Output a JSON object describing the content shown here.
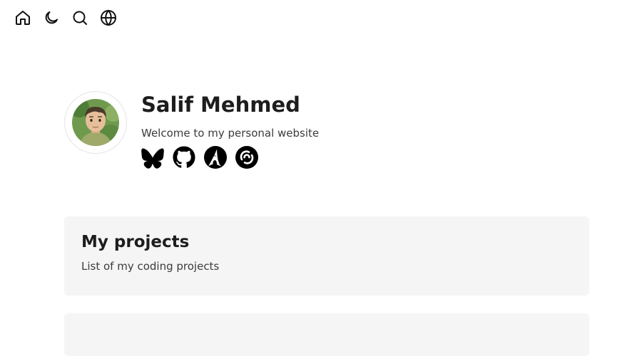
{
  "nav": {
    "items": [
      {
        "icon": "home-icon"
      },
      {
        "icon": "moon-icon"
      },
      {
        "icon": "search-icon"
      },
      {
        "icon": "globe-icon"
      }
    ]
  },
  "profile": {
    "name": "Salif Mehmed",
    "tagline": "Welcome to my personal website",
    "avatar_icon": "avatar-illustration",
    "socials": [
      {
        "icon": "bluesky-icon"
      },
      {
        "icon": "github-icon"
      },
      {
        "icon": "arch-icon"
      },
      {
        "icon": "keybase-icon"
      }
    ]
  },
  "sections": [
    {
      "title": "My projects",
      "description": "List of my coding projects"
    }
  ],
  "colors": {
    "text": "#1d1d1d",
    "card_bg": "#f5f5f5"
  }
}
